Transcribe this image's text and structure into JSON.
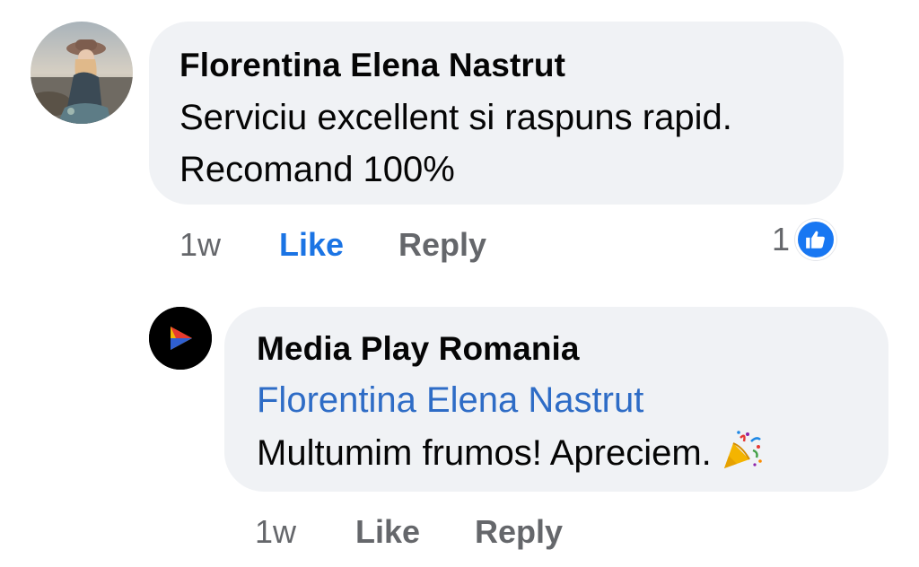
{
  "colors": {
    "bubble_bg": "#f0f2f5",
    "text": "#050505",
    "secondary_text": "#65676b",
    "link_blue": "#2e6cc6",
    "like_active_blue": "#1b74e4",
    "like_badge_blue": "#1877f2"
  },
  "comments": [
    {
      "author": "Florentina Elena Nastrut",
      "lines": [
        "Serviciu excellent si raspuns rapid.",
        "Recomand 100%"
      ],
      "time": "1w",
      "like_label": "Like",
      "like_active": true,
      "reply_label": "Reply",
      "reaction_count": "1",
      "reaction_icon": "thumbs-up-icon",
      "avatar": "user-photo-avatar"
    },
    {
      "author": "Media Play Romania",
      "mention": "Florentina Elena Nastrut",
      "text": "Multumim frumos! Apreciem.",
      "emoji": "party-popper-icon",
      "time": "1w",
      "like_label": "Like",
      "like_active": false,
      "reply_label": "Reply",
      "avatar": "media-play-logo-avatar"
    }
  ]
}
